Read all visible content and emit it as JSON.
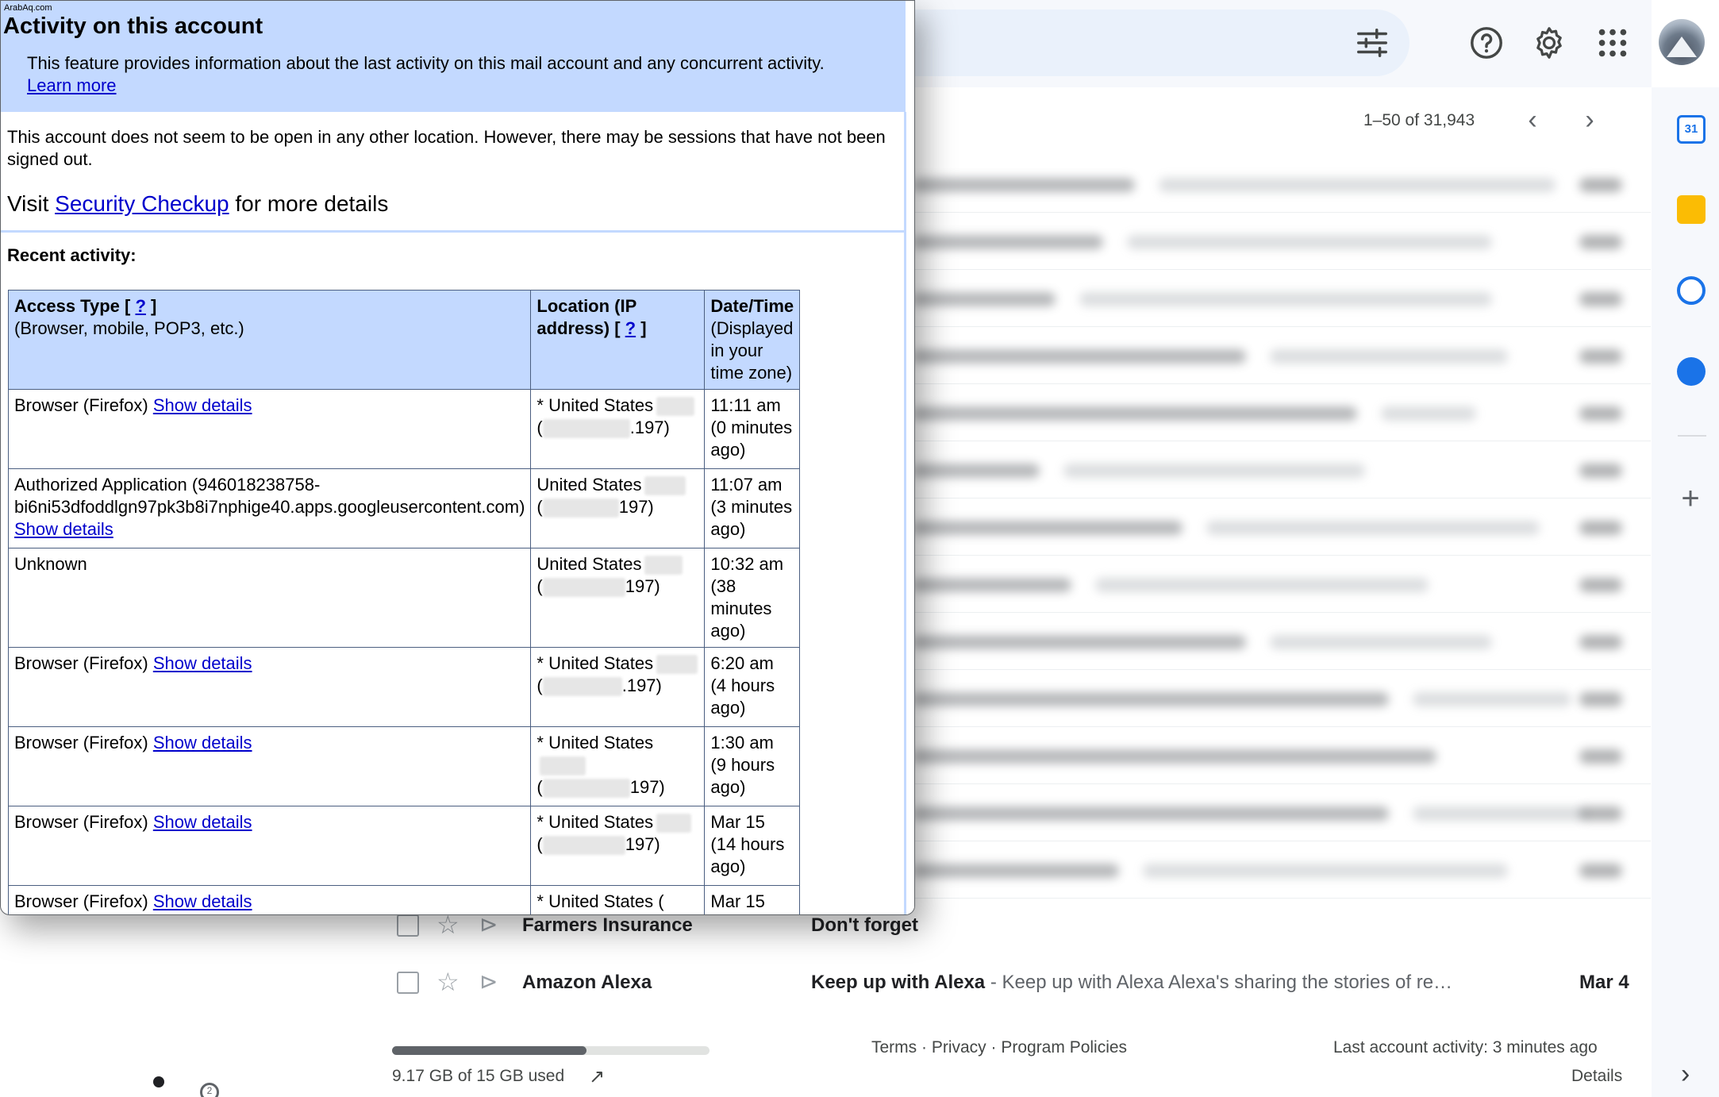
{
  "gmail": {
    "pagination": "1–50 of 31,943",
    "emails": [
      {
        "sender": "Farmers Insurance",
        "subject": "Don't forget",
        "snippet": "",
        "date": ""
      },
      {
        "sender": "Amazon Alexa",
        "subject": "Keep up with Alexa",
        "snippet": " - Keep up with Alexa Alexa's sharing the stories of re…",
        "date": "Mar 4"
      }
    ],
    "storage": {
      "text": "9.17 GB of 15 GB used",
      "used_gb": 9.17,
      "total_gb": 15
    },
    "footer_links": "Terms · Privacy · Program Policies",
    "last_activity": "Last account activity: 3 minutes ago",
    "details": "Details",
    "calendar_day": "31",
    "side_add": "+",
    "side_collapse": "›",
    "left_badge": "2",
    "pager_prev": "‹",
    "pager_next": "›",
    "colors": {
      "calendar": "#1a73e8",
      "keep": "#fbbc04",
      "tasks": "#1a73e8",
      "contacts": "#1a73e8",
      "header_blue": "#c3d9ff",
      "link": "#0000cc"
    }
  },
  "popup": {
    "watermark": "ArabAq.com",
    "title": "Activity on this account",
    "description": "This feature provides information about the last activity on this mail account and any concurrent activity.",
    "learn_more": "Learn more",
    "summary": "This account does not seem to be open in any other location. However, there may be sessions that have not been signed out.",
    "visit_prefix": "Visit ",
    "visit_link": "Security Checkup",
    "visit_suffix": " for more details",
    "recent_label": "Recent activity:",
    "columns": {
      "access": {
        "title": "Access Type [",
        "help": "?",
        "close": "]",
        "sub": "(Browser, mobile, POP3, etc.)"
      },
      "location": {
        "title": "Location (IP address) [",
        "help": "?",
        "close": "]"
      },
      "datetime": {
        "title": "Date/Time",
        "sub": "(Displayed in your time zone)"
      }
    },
    "rows": [
      {
        "access": "Browser (Firefox)",
        "show_details": "Show details",
        "location": "* United States",
        "ip_open": "(",
        "ip": ".197)",
        "time": "11:11 am",
        "ago": "(0 minutes ago)"
      },
      {
        "access": "Authorized Application (946018238758-bi6ni53dfoddlgn97pk3b8i7nphige40.apps.googleusercontent.com)",
        "show_details": "Show details",
        "location": "United States",
        "ip_open": "(",
        "ip": "197)",
        "time": "11:07 am",
        "ago": "(3 minutes ago)"
      },
      {
        "access": "Unknown",
        "show_details": "",
        "location": "United States",
        "ip_open": "(",
        "ip": "197)",
        "time": "10:32 am",
        "ago": "(38 minutes ago)"
      },
      {
        "access": "Browser (Firefox)",
        "show_details": "Show details",
        "location": "* United States",
        "ip_open": "(",
        "ip": ".197)",
        "time": "6:20 am",
        "ago": "(4 hours ago)"
      },
      {
        "access": "Browser (Firefox)",
        "show_details": "Show details",
        "location": "* United States",
        "ip_open": "(",
        "ip": "197)",
        "time": "1:30 am",
        "ago": "(9 hours ago)"
      },
      {
        "access": "Browser (Firefox)",
        "show_details": "Show details",
        "location": "* United States",
        "ip_open": "(",
        "ip": "197)",
        "time": "Mar 15",
        "ago": "(14 hours ago)"
      },
      {
        "access": "Browser (Firefox)",
        "show_details": "Show details",
        "location": "* United States (",
        "ip_open": "",
        "ip": "",
        "time": "Mar 15",
        "ago": ""
      }
    ]
  }
}
